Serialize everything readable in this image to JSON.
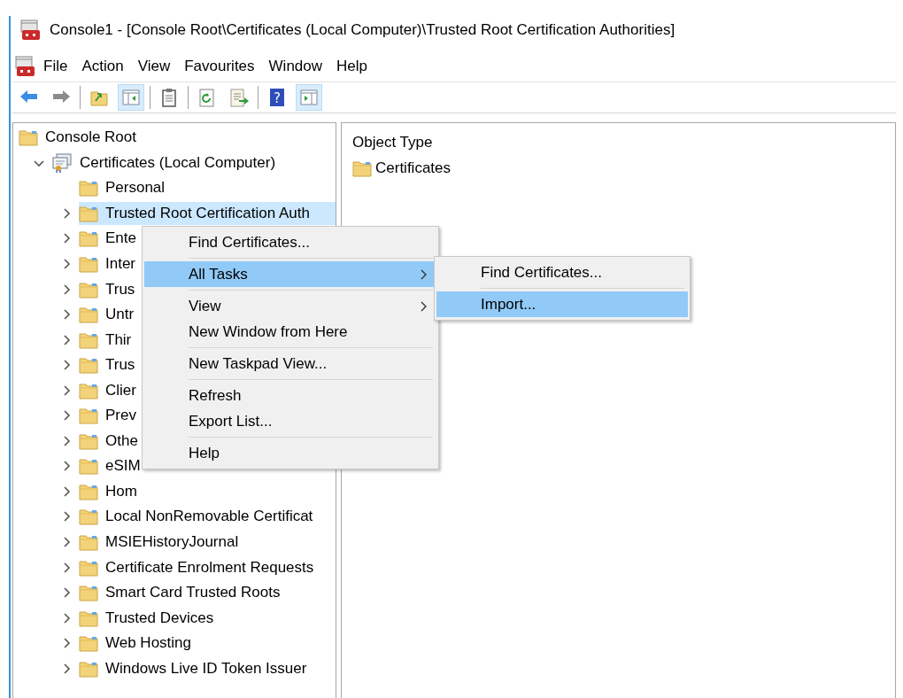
{
  "window": {
    "title": "Console1 - [Console Root\\Certificates (Local Computer)\\Trusted Root Certification Authorities]"
  },
  "menubar": [
    "File",
    "Action",
    "View",
    "Favourites",
    "Window",
    "Help"
  ],
  "toolbar": [
    {
      "kind": "back",
      "pressed": false
    },
    {
      "kind": "forward",
      "pressed": false
    },
    {
      "kind": "separator"
    },
    {
      "kind": "up",
      "pressed": false
    },
    {
      "kind": "tree",
      "pressed": true
    },
    {
      "kind": "separator"
    },
    {
      "kind": "clipboard",
      "pressed": false
    },
    {
      "kind": "separator"
    },
    {
      "kind": "refresh",
      "pressed": false
    },
    {
      "kind": "export",
      "pressed": false
    },
    {
      "kind": "separator"
    },
    {
      "kind": "help",
      "pressed": false,
      "glyph": "?"
    },
    {
      "kind": "action",
      "pressed": true
    }
  ],
  "tree": [
    {
      "label": "Console Root",
      "kind": "folder",
      "selected": false,
      "children": [
        {
          "label": "Certificates (Local Computer)",
          "kind": "store",
          "selected": false,
          "expanded": true,
          "children": [
            {
              "label": "Personal",
              "kind": "folder",
              "selected": false
            },
            {
              "label": "Trusted Root Certification Auth",
              "kind": "folder",
              "selected": true,
              "expanded": false
            },
            {
              "label": "Ente",
              "kind": "folder",
              "selected": false,
              "expanded": false
            },
            {
              "label": "Inter",
              "kind": "folder",
              "selected": false,
              "expanded": false
            },
            {
              "label": "Trus",
              "kind": "folder",
              "selected": false,
              "expanded": false
            },
            {
              "label": "Untr",
              "kind": "folder",
              "selected": false,
              "expanded": false
            },
            {
              "label": "Thir",
              "kind": "folder",
              "selected": false,
              "expanded": false
            },
            {
              "label": "Trus",
              "kind": "folder",
              "selected": false,
              "expanded": false
            },
            {
              "label": "Clier",
              "kind": "folder",
              "selected": false,
              "expanded": false
            },
            {
              "label": "Prev",
              "kind": "folder",
              "selected": false,
              "expanded": false
            },
            {
              "label": "Othe",
              "kind": "folder",
              "selected": false,
              "expanded": false
            },
            {
              "label": "eSIM",
              "kind": "folder",
              "selected": false,
              "expanded": false
            },
            {
              "label": "Hom",
              "kind": "folder",
              "selected": false,
              "expanded": false
            },
            {
              "label": "Local NonRemovable Certificat",
              "kind": "folder",
              "selected": false,
              "expanded": false
            },
            {
              "label": "MSIEHistoryJournal",
              "kind": "folder",
              "selected": false,
              "expanded": false
            },
            {
              "label": "Certificate Enrolment Requests",
              "kind": "folder",
              "selected": false,
              "expanded": false
            },
            {
              "label": "Smart Card Trusted Roots",
              "kind": "folder",
              "selected": false,
              "expanded": false
            },
            {
              "label": "Trusted Devices",
              "kind": "folder",
              "selected": false,
              "expanded": false
            },
            {
              "label": "Web Hosting",
              "kind": "folder",
              "selected": false,
              "expanded": false
            },
            {
              "label": "Windows Live ID Token Issuer",
              "kind": "folder",
              "selected": false,
              "expanded": false
            }
          ]
        }
      ]
    }
  ],
  "details": {
    "column": "Object Type",
    "rows": [
      {
        "label": "Certificates"
      }
    ]
  },
  "context_menu": [
    {
      "kind": "item",
      "label": "Find Certificates...",
      "selected": false,
      "submenu": false
    },
    {
      "kind": "separator"
    },
    {
      "kind": "item",
      "label": "All Tasks",
      "selected": true,
      "submenu": true
    },
    {
      "kind": "separator"
    },
    {
      "kind": "item",
      "label": "View",
      "selected": false,
      "submenu": true
    },
    {
      "kind": "item",
      "label": "New Window from Here",
      "selected": false,
      "submenu": false
    },
    {
      "kind": "separator"
    },
    {
      "kind": "item",
      "label": "New Taskpad View...",
      "selected": false,
      "submenu": false
    },
    {
      "kind": "separator"
    },
    {
      "kind": "item",
      "label": "Refresh",
      "selected": false,
      "submenu": false
    },
    {
      "kind": "item",
      "label": "Export List...",
      "selected": false,
      "submenu": false
    },
    {
      "kind": "separator"
    },
    {
      "kind": "item",
      "label": "Help",
      "selected": false,
      "submenu": false
    }
  ],
  "submenu": [
    {
      "kind": "item",
      "label": "Find Certificates...",
      "selected": false
    },
    {
      "kind": "separator"
    },
    {
      "kind": "item",
      "label": "Import...",
      "selected": true
    }
  ]
}
